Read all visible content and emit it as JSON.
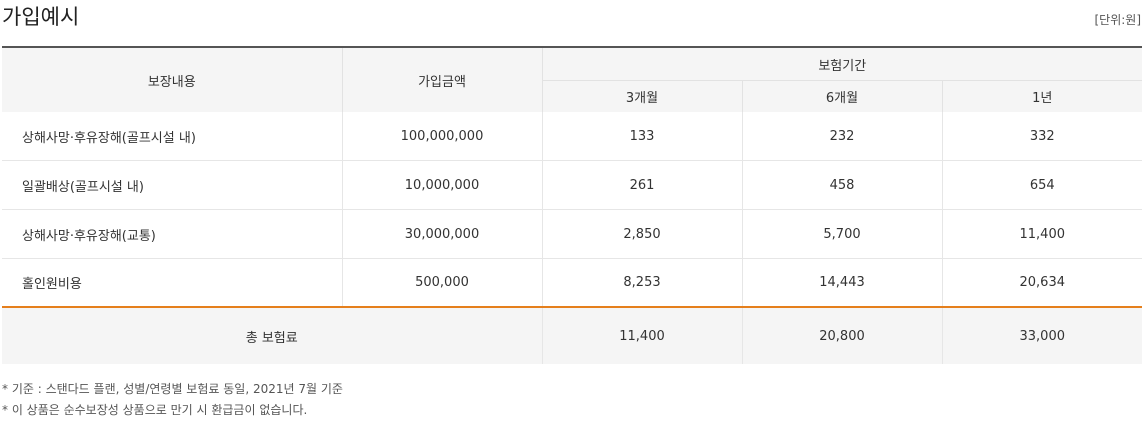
{
  "header": {
    "title": "가입예시",
    "unit": "[단위:원]"
  },
  "table": {
    "columns": {
      "coverage": "보장내용",
      "amount": "가입금액",
      "period": "보험기간",
      "periods": [
        "3개월",
        "6개월",
        "1년"
      ]
    },
    "rows": [
      {
        "coverage": "상해사망·후유장해(골프시설 내)",
        "amount": "100,000,000",
        "p1": "133",
        "p2": "232",
        "p3": "332"
      },
      {
        "coverage": "일괄배상(골프시설 내)",
        "amount": "10,000,000",
        "p1": "261",
        "p2": "458",
        "p3": "654"
      },
      {
        "coverage": "상해사망·후유장해(교통)",
        "amount": "30,000,000",
        "p1": "2,850",
        "p2": "5,700",
        "p3": "11,400"
      },
      {
        "coverage": "홀인원비용",
        "amount": "500,000",
        "p1": "8,253",
        "p2": "14,443",
        "p3": "20,634"
      }
    ],
    "total": {
      "label": "총 보험료",
      "p1": "11,400",
      "p2": "20,800",
      "p3": "33,000"
    }
  },
  "notes": [
    "* 기준 : 스탠다드 플랜, 성별/연령별 보험료 동일, 2021년 7월 기준",
    "* 이 상품은 순수보장성 상품으로 만기 시 환급금이 없습니다."
  ],
  "colors": {
    "accent_line": "#e57f1c",
    "header_bg": "#f5f5f5"
  }
}
